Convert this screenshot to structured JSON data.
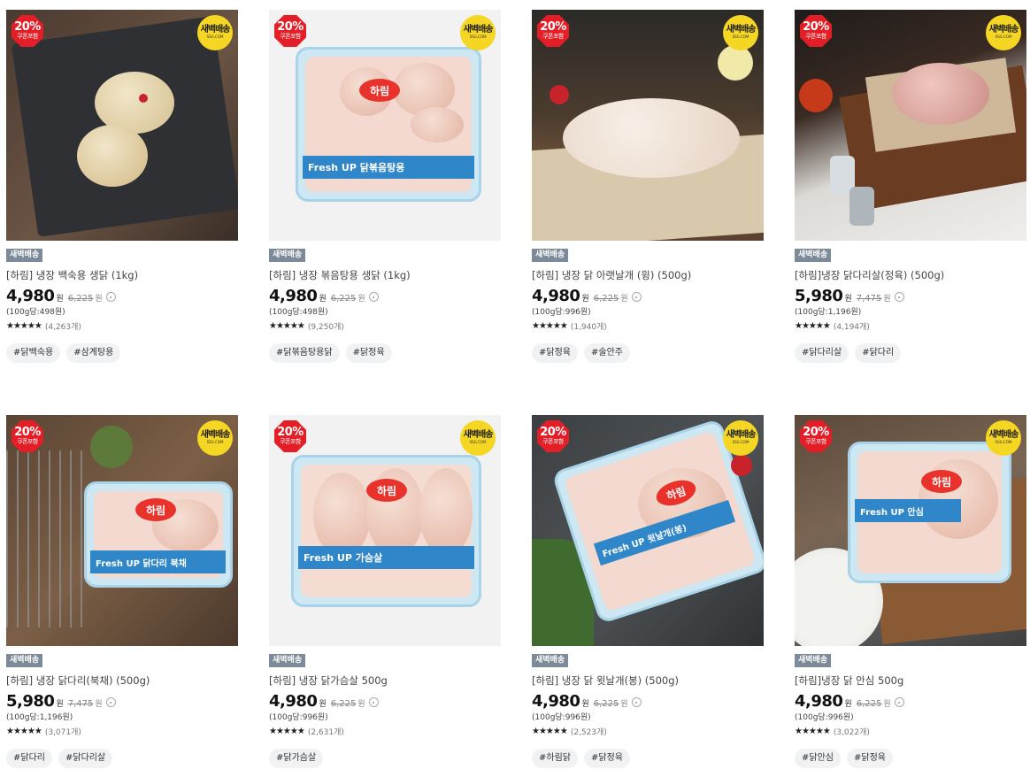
{
  "badges": {
    "coupon_pct": "20%",
    "coupon_label": "쿠폰포함",
    "dawn_title": "새벽배송",
    "dawn_sub": "SSG.COM"
  },
  "products": [
    {
      "delivery_tag": "새벽배송",
      "name": "[하림] 냉장 백숙용 생닭 (1kg)",
      "price": "4,980",
      "won": "원",
      "original_price": "6,225",
      "unit_price": "(100g당:498원)",
      "stars": "★★★★★",
      "review_count": "(4,263개)",
      "hashtags": [
        "#닭백숙용",
        "#삼계탕용"
      ],
      "has_coupon": true
    },
    {
      "delivery_tag": "새벽배송",
      "name": "[하림] 냉장 볶음탕용 생닭 (1kg)",
      "price": "4,980",
      "won": "원",
      "original_price": "6,225",
      "unit_price": "(100g당:498원)",
      "stars": "★★★★★",
      "review_count": "(9,250개)",
      "hashtags": [
        "#닭볶음탕용닭",
        "#닭정육"
      ],
      "has_coupon": true,
      "package_text": "Fresh UP 닭볶음탕용",
      "brand": "하림"
    },
    {
      "delivery_tag": "새벽배송",
      "name": "[하림] 냉장 닭 아랫날개 (윙) (500g)",
      "price": "4,980",
      "won": "원",
      "original_price": "6,225",
      "unit_price": "(100g당:996원)",
      "stars": "★★★★★",
      "review_count": "(1,940개)",
      "hashtags": [
        "#닭정육",
        "#술안주"
      ],
      "has_coupon": true
    },
    {
      "delivery_tag": "새벽배송",
      "name": "[하림]냉장 닭다리살(정육) (500g)",
      "price": "5,980",
      "won": "원",
      "original_price": "7,475",
      "unit_price": "(100g당:1,196원)",
      "stars": "★★★★★",
      "review_count": "(4,194개)",
      "hashtags": [
        "#닭다리살",
        "#닭다리"
      ],
      "has_coupon": true
    },
    {
      "delivery_tag": "새벽배송",
      "name": "[하림] 냉장 닭다리(북채) (500g)",
      "price": "5,980",
      "won": "원",
      "original_price": "7,475",
      "unit_price": "(100g당:1,196원)",
      "stars": "★★★★★",
      "review_count": "(3,071개)",
      "hashtags": [
        "#닭다리",
        "#닭다리살"
      ],
      "has_coupon": true,
      "package_text": "Fresh UP 닭다리 북채",
      "brand": "하림"
    },
    {
      "delivery_tag": "새벽배송",
      "name": "[하림] 냉장 닭가슴살 500g",
      "price": "4,980",
      "won": "원",
      "original_price": "6,225",
      "unit_price": "(100g당:996원)",
      "stars": "★★★★★",
      "review_count": "(2,631개)",
      "hashtags": [
        "#닭가슴살"
      ],
      "has_coupon": true,
      "package_text": "Fresh UP 가슴살",
      "brand": "하림"
    },
    {
      "delivery_tag": "새벽배송",
      "name": "[하림] 냉장 닭 윗날개(봉) (500g)",
      "price": "4,980",
      "won": "원",
      "original_price": "6,225",
      "unit_price": "(100g당:996원)",
      "stars": "★★★★★",
      "review_count": "(2,523개)",
      "hashtags": [
        "#하림닭",
        "#닭정육"
      ],
      "has_coupon": true,
      "package_text": "Fresh UP 윗날개(봉)",
      "brand": "하림"
    },
    {
      "delivery_tag": "새벽배송",
      "name": "[하림]냉장 닭 안심 500g",
      "price": "4,980",
      "won": "원",
      "original_price": "6,225",
      "unit_price": "(100g당:996원)",
      "stars": "★★★★★",
      "review_count": "(3,022개)",
      "hashtags": [
        "#닭안심",
        "#닭정육"
      ],
      "has_coupon": true,
      "package_text": "Fresh UP 안심",
      "brand": "하림"
    }
  ]
}
